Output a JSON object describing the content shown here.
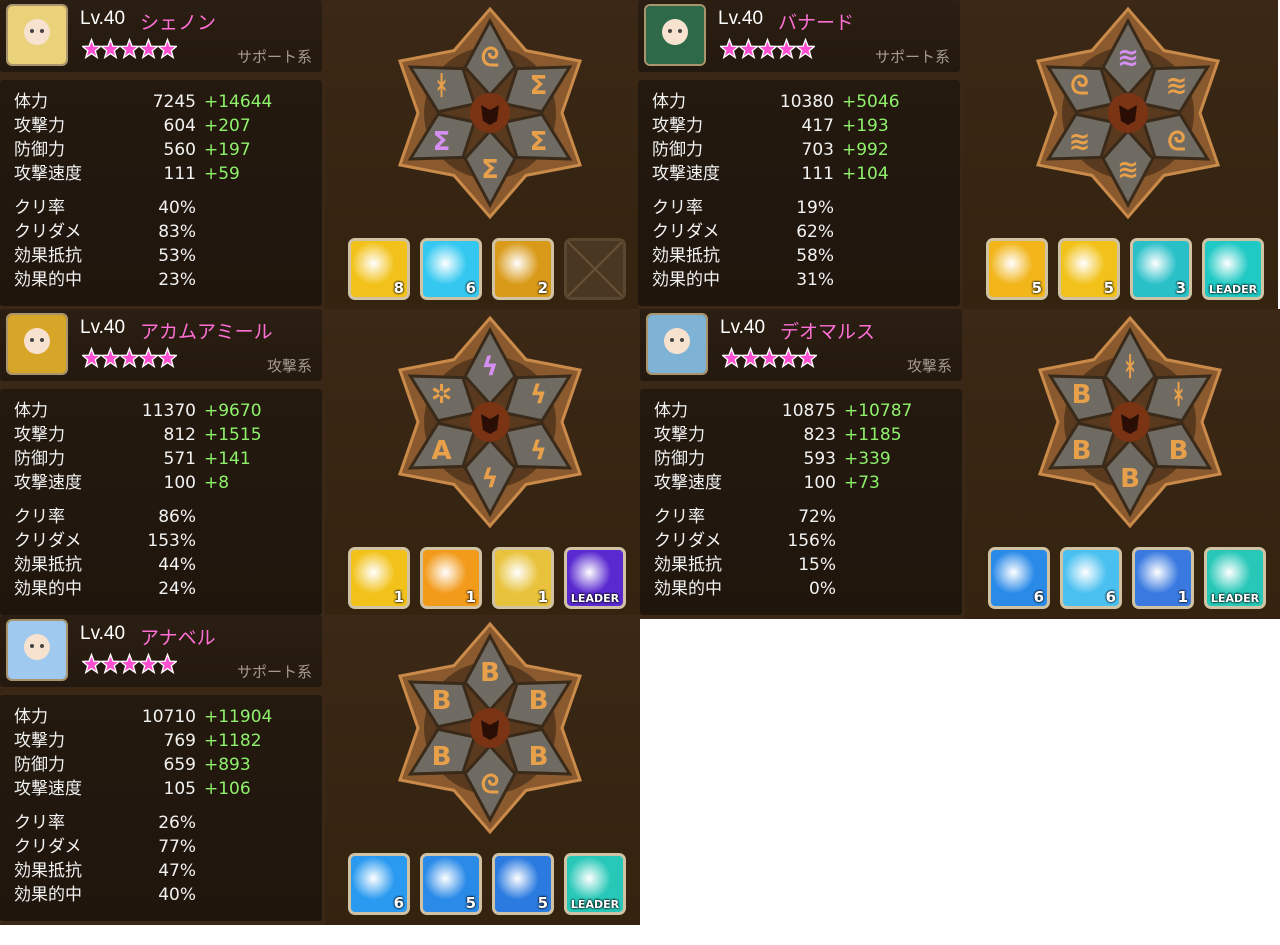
{
  "stat_labels": {
    "hp": "体力",
    "atk": "攻撃力",
    "def": "防御力",
    "spd": "攻撃速度",
    "crate": "クリ率",
    "cdmg": "クリダメ",
    "res": "効果抵抗",
    "acc": "効果的中"
  },
  "monsters": [
    {
      "level": "Lv.40",
      "name": "シェノン",
      "role": "サポート系",
      "stars": 5,
      "portrait_color": "#e9d27a",
      "hp": "7245",
      "hp_bonus": "+14644",
      "atk": "604",
      "atk_bonus": "+207",
      "def": "560",
      "def_bonus": "+197",
      "spd": "111",
      "spd_bonus": "+59",
      "crate": "40%",
      "cdmg": "83%",
      "res": "53%",
      "acc": "23%",
      "rune_glyphs": [
        "ᘓ",
        "Σ",
        "Σ",
        "Σ",
        "Σ",
        "ᚼ"
      ],
      "rune_colors": [
        "#e8a04a",
        "#e8a04a",
        "#e8a04a",
        "#e8a04a",
        "#d48ff0",
        "#e8a04a"
      ],
      "skills": [
        {
          "icon": "fire-fist-icon",
          "color": "#f2c21a",
          "level": "8"
        },
        {
          "icon": "ice-slash-icon",
          "color": "#34c8f0",
          "level": "6"
        },
        {
          "icon": "trident-icon",
          "color": "#d99a1a",
          "level": "2"
        },
        {
          "icon": "empty-slot-icon",
          "color": "#4a3722",
          "level": ""
        }
      ]
    },
    {
      "level": "Lv.40",
      "name": "バナード",
      "role": "サポート系",
      "stars": 5,
      "portrait_color": "#2e6a4a",
      "hp": "10380",
      "hp_bonus": "+5046",
      "atk": "417",
      "atk_bonus": "+193",
      "def": "703",
      "def_bonus": "+992",
      "spd": "111",
      "spd_bonus": "+104",
      "crate": "19%",
      "cdmg": "62%",
      "res": "58%",
      "acc": "31%",
      "rune_glyphs": [
        "≋",
        "≋",
        "ᘓ",
        "≋",
        "≋",
        "ᘓ"
      ],
      "rune_colors": [
        "#d48ff0",
        "#e8a04a",
        "#e8a04a",
        "#e8a04a",
        "#e8a04a",
        "#e8a04a"
      ],
      "skills": [
        {
          "icon": "claw-icon",
          "color": "#f2b51a",
          "level": "5"
        },
        {
          "icon": "lightning-icon",
          "color": "#f2c21a",
          "level": "5"
        },
        {
          "icon": "wind-blade-icon",
          "color": "#2ac0c8",
          "level": "3"
        },
        {
          "icon": "leader-sword-icon",
          "color": "#1fc9c4",
          "level": "",
          "leader": "LEADER"
        }
      ]
    },
    {
      "level": "Lv.40",
      "name": "アカムアミール",
      "role": "攻撃系",
      "stars": 5,
      "portrait_color": "#d7a528",
      "hp": "11370",
      "hp_bonus": "+9670",
      "atk": "812",
      "atk_bonus": "+1515",
      "def": "571",
      "def_bonus": "+141",
      "spd": "100",
      "spd_bonus": "+8",
      "crate": "86%",
      "cdmg": "153%",
      "res": "44%",
      "acc": "24%",
      "rune_glyphs": [
        "ϟ",
        "ϟ",
        "ϟ",
        "ϟ",
        "A",
        "✲"
      ],
      "rune_colors": [
        "#d48ff0",
        "#e8a04a",
        "#e8a04a",
        "#e8a04a",
        "#e8a04a",
        "#e8a04a"
      ],
      "skills": [
        {
          "icon": "spear-strike-icon",
          "color": "#f2c21a",
          "level": "1"
        },
        {
          "icon": "flame-burst-icon",
          "color": "#f29a1a",
          "level": "1"
        },
        {
          "icon": "golden-blade-icon",
          "color": "#e8c23a",
          "level": "1"
        },
        {
          "icon": "leader-target-icon",
          "color": "#5a2ad0",
          "level": "",
          "leader": "LEADER"
        }
      ]
    },
    {
      "level": "Lv.40",
      "name": "デオマルス",
      "role": "攻撃系",
      "stars": 5,
      "portrait_color": "#7fb3d6",
      "hp": "10875",
      "hp_bonus": "+10787",
      "atk": "823",
      "atk_bonus": "+1185",
      "def": "593",
      "def_bonus": "+339",
      "spd": "100",
      "spd_bonus": "+73",
      "crate": "72%",
      "cdmg": "156%",
      "res": "15%",
      "acc": "0%",
      "rune_glyphs": [
        "ᚼ",
        "ᚼ",
        "B",
        "B",
        "B",
        "B"
      ],
      "rune_colors": [
        "#e8a04a",
        "#e8a04a",
        "#e8a04a",
        "#e8a04a",
        "#e8a04a",
        "#e8a04a"
      ],
      "skills": [
        {
          "icon": "ice-slash-icon",
          "color": "#2a8ae8",
          "level": "6"
        },
        {
          "icon": "frost-burst-icon",
          "color": "#4ac0f0",
          "level": "6"
        },
        {
          "icon": "demon-silhouette-icon",
          "color": "#3a7ae0",
          "level": "1"
        },
        {
          "icon": "leader-orb-icon",
          "color": "#28c8b8",
          "level": "",
          "leader": "LEADER"
        }
      ]
    },
    {
      "level": "Lv.40",
      "name": "アナベル",
      "role": "サポート系",
      "stars": 5,
      "portrait_color": "#9fc9ee",
      "hp": "10710",
      "hp_bonus": "+11904",
      "atk": "769",
      "atk_bonus": "+1182",
      "def": "659",
      "def_bonus": "+893",
      "spd": "105",
      "spd_bonus": "+106",
      "crate": "26%",
      "cdmg": "77%",
      "res": "47%",
      "acc": "40%",
      "rune_glyphs": [
        "B",
        "B",
        "B",
        "ᘓ",
        "B",
        "B"
      ],
      "rune_colors": [
        "#e8a04a",
        "#e8a04a",
        "#e8a04a",
        "#e8a04a",
        "#e8a04a",
        "#e8a04a"
      ],
      "skills": [
        {
          "icon": "bear-icon",
          "color": "#2a9af0",
          "level": "6"
        },
        {
          "icon": "spirit-silhouette-icon",
          "color": "#2a8ae8",
          "level": "5"
        },
        {
          "icon": "angel-icon",
          "color": "#2a7ae0",
          "level": "5"
        },
        {
          "icon": "leader-orb-icon",
          "color": "#28c8b8",
          "level": "",
          "leader": "LEADER"
        }
      ]
    }
  ]
}
